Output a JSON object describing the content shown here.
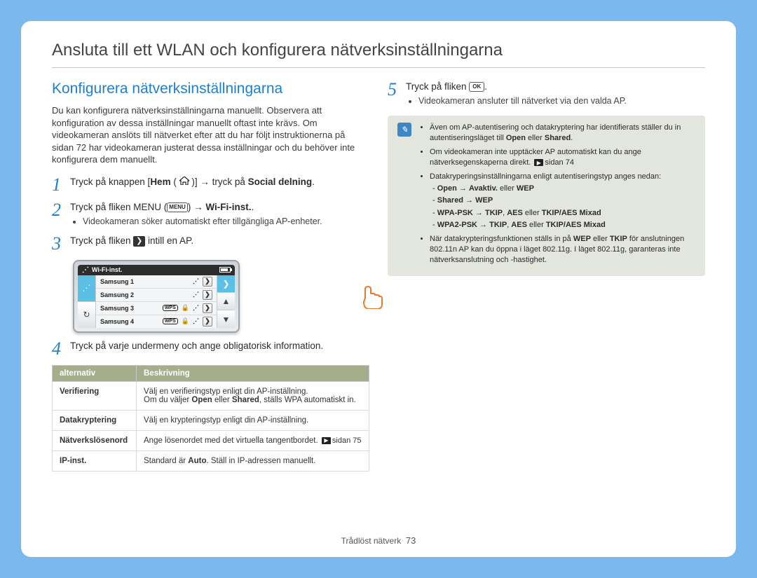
{
  "page_title": "Ansluta till ett WLAN och konfigurera nätverksinställningarna",
  "section_heading": "Konfigurera nätverksinställningarna",
  "intro": "Du kan konfigurera nätverksinställningarna manuellt. Observera att konfiguration av dessa inställningar manuellt oftast inte krävs. Om videokameran anslöts till nätverket efter att du har följt instruktionerna på sidan 72 har videokameran justerat dessa inställningar och du behöver inte konfigurera dem manuellt.",
  "steps": {
    "s1_pre": "Tryck på knappen [",
    "s1_hem": "Hem",
    "s1_mid": " ( ",
    "s1_aft": " )] → tryck på ",
    "s1_social": "Social delning",
    "s2_pre": "Tryck på fliken MENU (",
    "s2_menu_badge": "MENU",
    "s2_aft": ") → ",
    "s2_bold": "Wi-Fi-inst.",
    "s2_bullet": "Videokameran söker automatiskt efter tillgängliga AP-enheter.",
    "s3_pre": "Tryck på fliken ",
    "s3_aft": " intill en AP.",
    "s4": "Tryck på varje undermeny och ange obligatorisk information.",
    "s5_pre": "Tryck på fliken ",
    "s5_ok": "OK",
    "s5_aft": ".",
    "s5_bullet": "Videokameran ansluter till nätverket via den valda AP."
  },
  "device": {
    "title": "Wi-Fi-inst.",
    "aps": [
      {
        "name": "Samsung 1",
        "wps": false,
        "lock": false
      },
      {
        "name": "Samsung 2",
        "wps": false,
        "lock": false
      },
      {
        "name": "Samsung 3",
        "wps": true,
        "lock": true
      },
      {
        "name": "Samsung 4",
        "wps": true,
        "lock": true
      }
    ],
    "wps_label": "WPS"
  },
  "table": {
    "h1": "alternativ",
    "h2": "Beskrivning",
    "rows": [
      {
        "k": "Verifiering",
        "v_pre": "Välj en verifieringstyp enligt din AP-inställning.\nOm du väljer ",
        "v_b1": "Open",
        "v_mid": " eller ",
        "v_b2": "Shared",
        "v_post": ", ställs WPA automatiskt in."
      },
      {
        "k": "Datakryptering",
        "v": "Välj en krypteringstyp enligt din AP-inställning."
      },
      {
        "k": "Nätverkslösenord",
        "v_pre": "Ange lösenordet med det virtuella tangentbordet. ",
        "v_page": "sidan 75"
      },
      {
        "k": "IP-inst.",
        "v_pre": "Standard är ",
        "v_b1": "Auto",
        "v_post": ". Ställ in IP-adressen manuellt."
      }
    ]
  },
  "note": {
    "b1_pre": "Även om AP-autentisering och datakryptering har identifierats ställer du in autentiseringsläget till ",
    "b1_b1": "Open",
    "b1_mid": " eller ",
    "b1_b2": "Shared",
    "b1_post": ".",
    "b2_pre": "Om videokameran inte upptäcker AP automatiskt kan du ange nätverksegenskaperna direkt. ",
    "b2_page": "sidan 74",
    "b3": "Datakryperingsinställningarna enligt autentiseringstyp anges nedan:",
    "sub1_b1": "Open",
    "arrow": " → ",
    "sub1_b2": "Avaktiv.",
    "sub1_post": " eller ",
    "sub1_b3": "WEP",
    "sub2_b1": "Shared",
    "sub2_b2": "WEP",
    "sub3_b1": "WPA-PSK",
    "sub3_b2": "TKIP",
    "sub3_b3": "AES",
    "sub3_mid": " eller ",
    "sub3_b4": "TKIP/AES Mixad",
    "sub4_b1": "WPA2-PSK",
    "b4_pre": "När datakrypteringsfunktionen ställs in på ",
    "b4_b1": "WEP",
    "b4_mid1": " eller ",
    "b4_b2": "TKIP",
    "b4_mid2": " för anslutningen 802.11n AP kan du öppna i läget 802.11g. I läget 802.11g, garanteras inte nätverksanslutning och -hastighet."
  },
  "footer": {
    "label": "Trådlöst nätverk",
    "page": "73"
  }
}
